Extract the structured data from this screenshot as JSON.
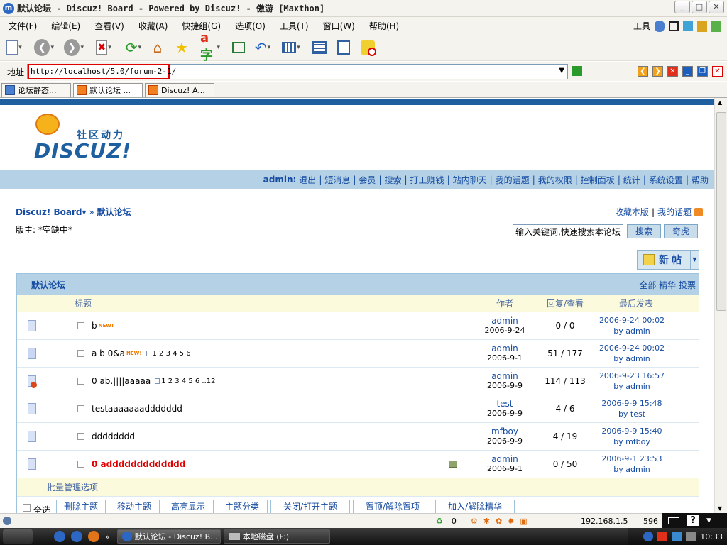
{
  "window": {
    "title": "默认论坛 - Discuz! Board - Powered by Discuz! - 傲游 [Maxthon]"
  },
  "menu": [
    "文件(F)",
    "编辑(E)",
    "查看(V)",
    "收藏(A)",
    "快捷组(G)",
    "选项(O)",
    "工具(T)",
    "窗口(W)",
    "帮助(H)"
  ],
  "menu_tools_label": "工具",
  "address": {
    "label": "地址",
    "url": "http://localhost/5.0/forum-2-1/"
  },
  "tabs": [
    {
      "label": "论坛静态..."
    },
    {
      "label": "默认论坛 ..."
    },
    {
      "label": "Discuz! A..."
    }
  ],
  "logo": {
    "slogan": "社区动力",
    "brand": "DISCUZ!"
  },
  "nav": {
    "user": "admin:",
    "links": [
      "退出",
      "短消息",
      "会员",
      "搜索",
      "打工赚钱",
      "站内聊天",
      "我的话题",
      "我的权限",
      "控制面板",
      "统计",
      "系统设置",
      "帮助"
    ]
  },
  "breadcrumb": {
    "home": "Discuz! Board",
    "arrow": "▾ »",
    "current": "默认论坛"
  },
  "moderator": "版主: *空缺中*",
  "top_links": {
    "fav": "收藏本版",
    "sep": "|",
    "my_topics": "我的话题"
  },
  "search": {
    "placeholder": "输入关键词,快速搜索本论坛",
    "button": "搜索",
    "button2": "奇虎"
  },
  "newpost": {
    "label": "新帖"
  },
  "forum": {
    "name": "默认论坛",
    "filters": "全部 精华 投票",
    "columns": {
      "title": "标题",
      "author": "作者",
      "replies": "回复/查看",
      "lastpost": "最后发表"
    },
    "threads": [
      {
        "title": "b",
        "new": "NEW!",
        "pages": "",
        "author": "admin",
        "date": "2006-9-24",
        "stats": "0 / 0",
        "last_time": "2006-9-24 00:02",
        "last_by": "by admin",
        "icon": "normal",
        "red": false,
        "attach": false
      },
      {
        "title": "a b 0&a",
        "new": "NEW!",
        "pages": "1 2 3 4 5 6",
        "author": "admin",
        "date": "2006-9-1",
        "stats": "51 / 177",
        "last_time": "2006-9-24 00:02",
        "last_by": "by admin",
        "icon": "hot",
        "red": false,
        "attach": false
      },
      {
        "title": "0 ab.||||aaaaa",
        "new": "",
        "pages": "1 2 3 4 5 6 ..12",
        "author": "admin",
        "date": "2006-9-9",
        "stats": "114 / 113",
        "last_time": "2006-9-23 16:57",
        "last_by": "by admin",
        "icon": "locked",
        "red": false,
        "attach": false
      },
      {
        "title": "testaaaaaaaddddddd",
        "new": "",
        "pages": "",
        "author": "test",
        "date": "2006-9-9",
        "stats": "4 / 6",
        "last_time": "2006-9-9 15:48",
        "last_by": "by test",
        "icon": "normal",
        "red": false,
        "attach": false
      },
      {
        "title": "dddddddd",
        "new": "",
        "pages": "",
        "author": "mfboy",
        "date": "2006-9-9",
        "stats": "4 / 19",
        "last_time": "2006-9-9 15:40",
        "last_by": "by mfboy",
        "icon": "normal",
        "red": false,
        "attach": false
      },
      {
        "title": "0 addddddddddddd",
        "new": "",
        "pages": "",
        "author": "admin",
        "date": "2006-9-1",
        "stats": "0 / 50",
        "last_time": "2006-9-1 23:53",
        "last_by": "by admin",
        "icon": "normal",
        "red": true,
        "attach": true
      }
    ],
    "batch_label": "批量管理选项",
    "actions": [
      "全选",
      "删除主题",
      "移动主题",
      "高亮显示",
      "主题分类",
      "关闭/打开主题",
      "置顶/解除置项",
      "加入/解除精华"
    ]
  },
  "status": {
    "count": "0",
    "ip": "192.168.1.5",
    "num": "596"
  },
  "taskbar": {
    "items": [
      "默认论坛 - Discuz! B...",
      "本地磁盘 (F:)"
    ],
    "clock": "10:33",
    "help": "?"
  },
  "colors": {
    "link": "#154ba0",
    "header_bg": "#b4d1e6",
    "col_bg": "#fcfadc",
    "accent_red": "#e00000"
  }
}
